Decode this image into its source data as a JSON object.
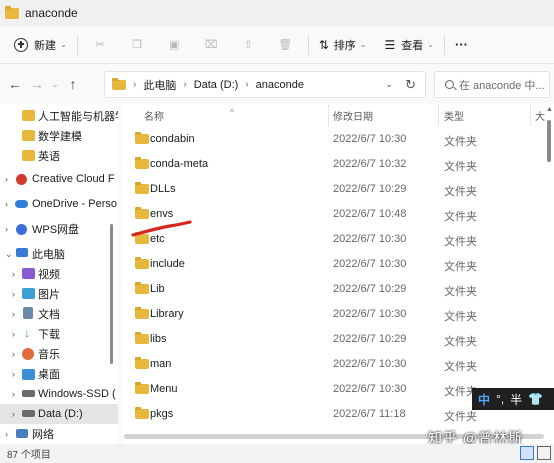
{
  "window": {
    "title": "anaconde"
  },
  "toolbar": {
    "new_label": "新建",
    "sort_label": "排序",
    "view_label": "查看",
    "more_label": "···"
  },
  "address": {
    "crumbs": [
      "此电脑",
      "Data (D:)",
      "anaconde"
    ]
  },
  "search": {
    "placeholder": "在 anaconde 中..."
  },
  "nav": {
    "items": [
      {
        "label": "人工智能与机器学",
        "color": "#e8b83c"
      },
      {
        "label": "数学建模",
        "color": "#e8b83c"
      },
      {
        "label": "英语",
        "color": "#e8b83c"
      },
      {
        "label": "Creative Cloud F",
        "color": "#d63a2f"
      },
      {
        "label": "OneDrive - Perso",
        "color": "#2f7fd6"
      },
      {
        "label": "WPS网盘",
        "color": "#3a6fd6"
      },
      {
        "label": "此电脑",
        "color": "#3a78d6"
      },
      {
        "label": "视频",
        "color": "#8a5bd6"
      },
      {
        "label": "图片",
        "color": "#3aa0d6"
      },
      {
        "label": "文档",
        "color": "#6b87a8"
      },
      {
        "label": "下载",
        "color": "#2f9a6a"
      },
      {
        "label": "音乐",
        "color": "#e06a3a"
      },
      {
        "label": "桌面",
        "color": "#3a8fd6"
      },
      {
        "label": "Windows-SSD (",
        "color": "#6b6b6b"
      },
      {
        "label": "Data (D:)",
        "color": "#6b6b6b"
      },
      {
        "label": "网络",
        "color": "#4a7fbf"
      }
    ]
  },
  "columns": {
    "name": "名称",
    "date": "修改日期",
    "type": "类型",
    "size": "大"
  },
  "files": [
    {
      "name": "condabin",
      "date": "2022/6/7 10:30",
      "type": "文件夹"
    },
    {
      "name": "conda-meta",
      "date": "2022/6/7 10:32",
      "type": "文件夹"
    },
    {
      "name": "DLLs",
      "date": "2022/6/7 10:29",
      "type": "文件夹"
    },
    {
      "name": "envs",
      "date": "2022/6/7 10:48",
      "type": "文件夹"
    },
    {
      "name": "etc",
      "date": "2022/6/7 10:30",
      "type": "文件夹"
    },
    {
      "name": "include",
      "date": "2022/6/7 10:30",
      "type": "文件夹"
    },
    {
      "name": "Lib",
      "date": "2022/6/7 10:29",
      "type": "文件夹"
    },
    {
      "name": "Library",
      "date": "2022/6/7 10:30",
      "type": "文件夹"
    },
    {
      "name": "libs",
      "date": "2022/6/7 10:29",
      "type": "文件夹"
    },
    {
      "name": "man",
      "date": "2022/6/7 10:30",
      "type": "文件夹"
    },
    {
      "name": "Menu",
      "date": "2022/6/7 10:30",
      "type": "文件夹"
    },
    {
      "name": "pkgs",
      "date": "2022/6/7 11:18",
      "type": "文件夹"
    }
  ],
  "status": {
    "count": "87 个项目"
  },
  "ime": {
    "mode": "中",
    "punct": "°,",
    "width": "半"
  },
  "watermark": "知乎 @普林斯",
  "colors": {
    "folder": "#e8b83c",
    "annotation": "#d9261c",
    "selection": "#e5e5e5"
  }
}
